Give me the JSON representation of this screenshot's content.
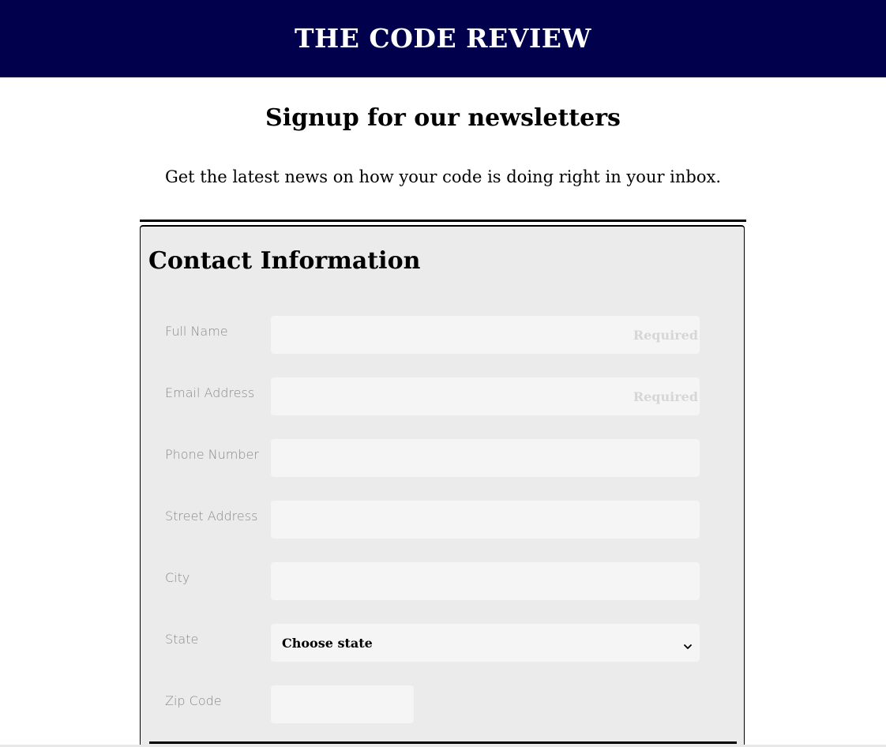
{
  "header": {
    "site_title": "THE CODE REVIEW",
    "background_color": "#00004d"
  },
  "main": {
    "heading": "Signup for our newsletters",
    "subtitle": "Get the latest news on how your code is doing right in your inbox."
  },
  "form": {
    "legend": "Contact Information",
    "fields": {
      "full_name": {
        "label": "Full Name",
        "placeholder": "Required",
        "value": ""
      },
      "email": {
        "label": "Email Address",
        "placeholder": "Required",
        "value": ""
      },
      "phone": {
        "label": "Phone Number",
        "placeholder": "",
        "value": ""
      },
      "street": {
        "label": "Street Address",
        "placeholder": "",
        "value": ""
      },
      "city": {
        "label": "City",
        "placeholder": "",
        "value": ""
      },
      "state": {
        "label": "State",
        "selected": "Choose state",
        "icon": "chevron-down-icon"
      },
      "zip": {
        "label": "Zip Code",
        "placeholder": "",
        "value": ""
      }
    },
    "background_color": "#ebebeb",
    "input_color": "#f5f5f5"
  }
}
